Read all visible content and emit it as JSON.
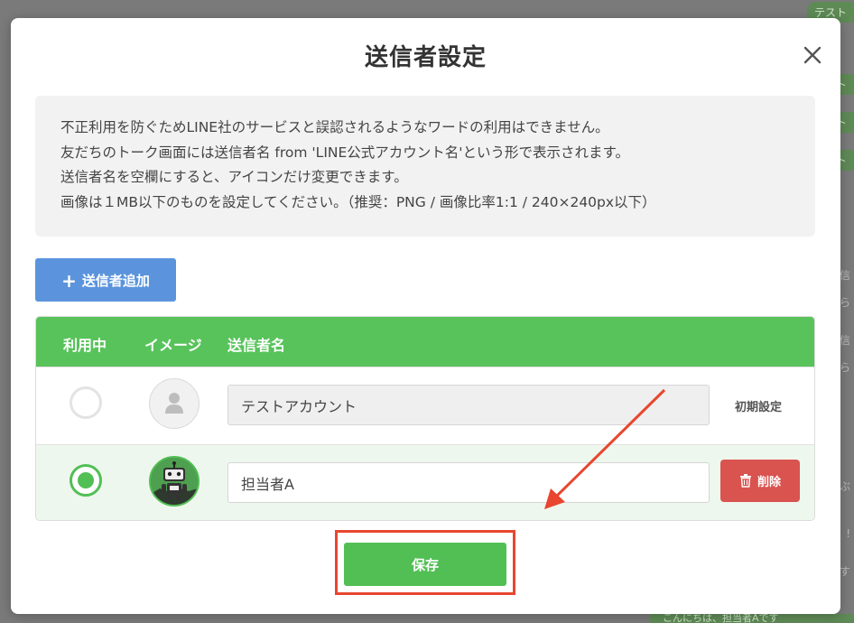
{
  "background": {
    "bubbles": [
      "テスト",
      "ト",
      "ト",
      "ト"
    ],
    "side_texts": [
      "信",
      "ら",
      "信",
      "ら",
      "!",
      "す",
      "ぶ"
    ],
    "bottom_text": "こんにちは、担当者Aです"
  },
  "modal": {
    "title": "送信者設定",
    "close_icon": "close-icon",
    "notice_lines": [
      "不正利用を防ぐためLINE社のサービスと誤認されるようなワードの利用はできません。",
      "友だちのトーク画面には送信者名 from 'LINE公式アカウント名'という形で表示されます。",
      "送信者名を空欄にすると、アイコンだけ変更できます。",
      "画像は１MB以下のものを設定してください。（推奨：PNG / 画像比率1:1 / 240×240px以下）"
    ],
    "add_button": {
      "icon": "plus-icon",
      "label": "送信者追加"
    },
    "table": {
      "headers": {
        "in_use": "利用中",
        "image": "イメージ",
        "sender_name": "送信者名"
      },
      "rows": [
        {
          "selected": false,
          "avatar": "default-user-icon",
          "name": "テストアカウント",
          "editable": false,
          "action_label": "初期設定"
        },
        {
          "selected": true,
          "avatar": "robot-icon",
          "name": "担当者A",
          "editable": true,
          "action_label": "削除",
          "action_icon": "trash-icon"
        }
      ]
    },
    "save_button": "保存"
  },
  "colors": {
    "accent_green": "#52bf55",
    "header_green": "#58c35b",
    "add_blue": "#5b94dc",
    "delete_red": "#d9534f",
    "annotation_red": "#e8462f"
  }
}
